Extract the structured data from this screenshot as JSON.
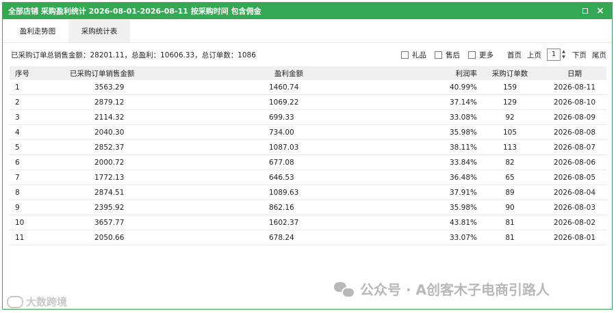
{
  "window": {
    "title": "全部店铺 采购盈利统计 2026-08-01-2026-08-11 按采购时间 包含佣金"
  },
  "tabs": [
    {
      "label": "盈利走势图",
      "active": false
    },
    {
      "label": "采购统计表",
      "active": true
    }
  ],
  "toolbar": {
    "summary": "已采购订单总销售金额：28201.11，总盈利：10606.33，总订单数：1086",
    "filters": [
      {
        "label": "礼品",
        "checked": false
      },
      {
        "label": "售后",
        "checked": false
      },
      {
        "label": "更多",
        "checked": false
      }
    ],
    "first_page": "首页",
    "prev_page": "上页",
    "page_number": "1",
    "next_page": "下页",
    "last_page": "尾页"
  },
  "table": {
    "headers": [
      "序号",
      "已采购订单销售金额",
      "盈利金额",
      "利润率",
      "采购订单数",
      "日期"
    ],
    "rows": [
      [
        "1",
        "3563.29",
        "1460.74",
        "40.99%",
        "159",
        "2026-08-11"
      ],
      [
        "2",
        "2879.12",
        "1069.22",
        "37.14%",
        "129",
        "2026-08-10"
      ],
      [
        "3",
        "2114.32",
        "699.33",
        "33.08%",
        "92",
        "2026-08-09"
      ],
      [
        "4",
        "2040.30",
        "734.00",
        "35.98%",
        "105",
        "2026-08-08"
      ],
      [
        "5",
        "2852.37",
        "1087.03",
        "38.11%",
        "113",
        "2026-08-07"
      ],
      [
        "6",
        "2000.72",
        "677.08",
        "33.84%",
        "82",
        "2026-08-06"
      ],
      [
        "7",
        "1772.13",
        "646.53",
        "36.48%",
        "65",
        "2026-08-05"
      ],
      [
        "8",
        "2874.51",
        "1089.63",
        "37.91%",
        "89",
        "2026-08-04"
      ],
      [
        "9",
        "2395.92",
        "862.16",
        "35.98%",
        "90",
        "2026-08-03"
      ],
      [
        "10",
        "3657.77",
        "1602.37",
        "43.81%",
        "81",
        "2026-08-02"
      ],
      [
        "11",
        "2050.66",
        "678.24",
        "33.07%",
        "81",
        "2026-08-01"
      ]
    ]
  },
  "watermarks": {
    "left": "大数跨境",
    "right": "公众号 · A创客木子电商引路人"
  },
  "colors": {
    "titlebar": "#35a853",
    "header_row": "#efefef"
  }
}
